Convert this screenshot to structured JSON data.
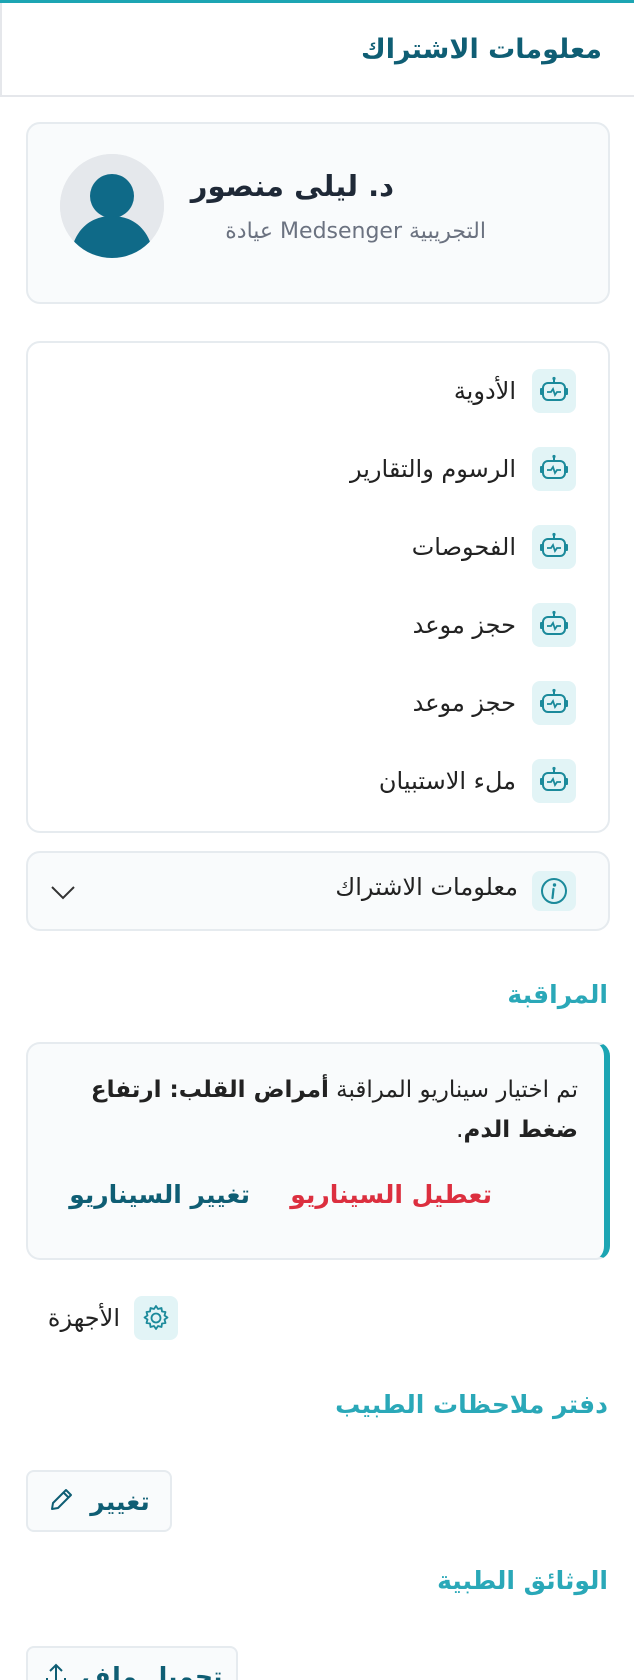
{
  "header": {
    "title": "معلومات الاشتراك"
  },
  "profile": {
    "name": "د. ليلى منصور",
    "clinic": "التجريبية Medsenger عيادة",
    "icon": "user-avatar-icon"
  },
  "menu": {
    "items": [
      {
        "label": "الأدوية",
        "icon": "robot-icon"
      },
      {
        "label": "الرسوم والتقارير",
        "icon": "robot-icon"
      },
      {
        "label": "الفحوصات",
        "icon": "robot-icon"
      },
      {
        "label": "حجز موعد",
        "icon": "robot-icon"
      },
      {
        "label": "حجز موعد",
        "icon": "robot-icon"
      },
      {
        "label": "ملء الاستبيان",
        "icon": "robot-icon"
      }
    ]
  },
  "subscription_info": {
    "label": "معلومات الاشتراك",
    "icon": "info-icon",
    "toggle_icon": "chevron-down-icon"
  },
  "monitoring": {
    "title": "المراقبة",
    "text_prefix": "تم اختيار سيناريو المراقبة ",
    "scenario": "أمراض القلب: ارتفاع ضغط الدم",
    "text_suffix": ".",
    "disable_label": "تعطيل السيناريو",
    "change_label": "تغيير السيناريو"
  },
  "devices": {
    "label": "الأجهزة",
    "icon": "gear-icon"
  },
  "notes": {
    "title": "دفتر ملاحظات الطبيب",
    "edit_label": "تغيير",
    "icon": "pencil-icon"
  },
  "documents": {
    "title": "الوثائق الطبية",
    "upload_label": "تحميل ملف",
    "icon": "upload-icon"
  },
  "colors": {
    "accent": "#1ca5b3",
    "primary_dark": "#0f5e74",
    "danger": "#dc2f3f",
    "icon_bg": "#e2f4f6"
  }
}
